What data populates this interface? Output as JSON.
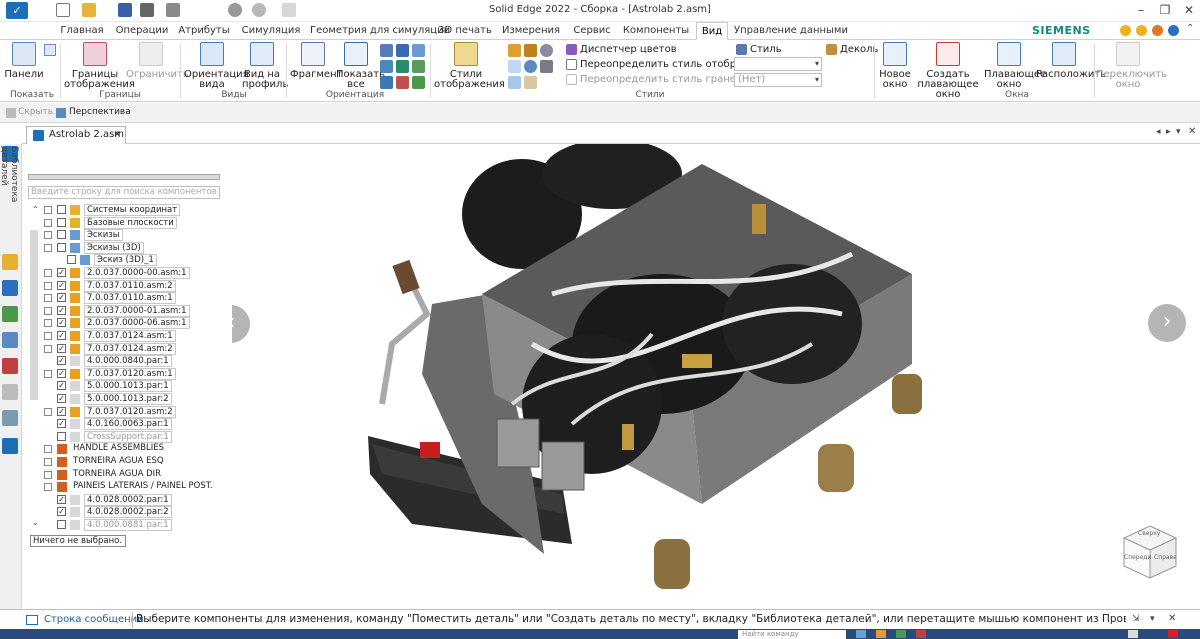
{
  "window": {
    "title": "Solid Edge 2022 - Сборка - [Astrolab 2.asm]",
    "brand": "SIEMENS",
    "brand_color": "#0f8a8a"
  },
  "ribbon_tabs": [
    {
      "label": "Главная"
    },
    {
      "label": "Операции"
    },
    {
      "label": "Атрибуты"
    },
    {
      "label": "Симуляция"
    },
    {
      "label": "Геометрия для симуляции"
    },
    {
      "label": "3D печать"
    },
    {
      "label": "Измерения"
    },
    {
      "label": "Сервис"
    },
    {
      "label": "Компоненты"
    },
    {
      "label": "Вид"
    },
    {
      "label": "Управление данными"
    }
  ],
  "active_tab": "Вид",
  "ribbon": {
    "panels_label": "Панели",
    "show_group": "Показать",
    "bounds_label": "Границы отображения",
    "limit_label": "Ограничить",
    "bounds_group": "Границы",
    "orient_label": "Ориентация вида",
    "profile_label": "Вид на профиль",
    "views_group": "Виды",
    "fragment_label": "Фрагмент",
    "showall_label": "Показать все",
    "orientation_group": "Ориентация",
    "styles_label": "Стили отображения",
    "color_mgr": "Диспетчер цветов",
    "override_display": "Переопределить стиль отображения",
    "override_faces": "Переопределить стиль граней",
    "style_label": "Стиль",
    "decal_label": "Деколь",
    "net_value": "(Нет)",
    "styles_group": "Стили",
    "new_window": "Новое окно",
    "create_floating": "Создать плавающее окно",
    "floating_window": "Плавающее окно",
    "arrange": "Расположить",
    "switch_window": "Переключить окно",
    "window_group": "Окна"
  },
  "subbar": {
    "hide": "Скрыть",
    "perspective": "Перспектива"
  },
  "doc_tab": "Astrolab 2.asm",
  "side_label": "Библиотека деталей",
  "search_placeholder": "Введите строку для поиска компонентов",
  "tree": [
    {
      "label": "Системы координат",
      "expand": true,
      "check": false,
      "kind": "sys",
      "dim": false
    },
    {
      "label": "Базовые плоскости",
      "expand": true,
      "check": false,
      "kind": "plane",
      "dim": false
    },
    {
      "label": "Эскизы",
      "expand": true,
      "check": false,
      "kind": "sketch",
      "dim": false
    },
    {
      "label": "Эскизы (3D)",
      "expand": true,
      "check": false,
      "kind": "sketch",
      "dim": false
    },
    {
      "label": "Эскиз (3D)_1",
      "expand": false,
      "check": false,
      "kind": "sketch",
      "dim": false,
      "indent": 1
    },
    {
      "label": "2.0.037.0000-00.asm:1",
      "expand": true,
      "check": true,
      "kind": "asm",
      "dim": false
    },
    {
      "label": "7.0.037.0110.asm:2",
      "expand": true,
      "check": true,
      "kind": "asm",
      "dim": false
    },
    {
      "label": "7.0.037.0110.asm:1",
      "expand": true,
      "check": true,
      "kind": "asm",
      "dim": false
    },
    {
      "label": "2.0.037.0000-01.asm:1",
      "expand": true,
      "check": true,
      "kind": "asm",
      "dim": false
    },
    {
      "label": "2.0.037.0000-06.asm:1",
      "expand": true,
      "check": true,
      "kind": "asm",
      "dim": false
    },
    {
      "label": "7.0.037.0124.asm:1",
      "expand": true,
      "check": true,
      "kind": "asm",
      "dim": false
    },
    {
      "label": "7.0.037.0124.asm:2",
      "expand": true,
      "check": true,
      "kind": "asm",
      "dim": false
    },
    {
      "label": "4.0.000.0840.par:1",
      "expand": false,
      "check": true,
      "kind": "par",
      "dim": false
    },
    {
      "label": "7.0.037.0120.asm:1",
      "expand": true,
      "check": true,
      "kind": "asm",
      "dim": false
    },
    {
      "label": "5.0.000.1013.par:1",
      "expand": false,
      "check": true,
      "kind": "par",
      "dim": false
    },
    {
      "label": "5.0.000.1013.par:2",
      "expand": false,
      "check": true,
      "kind": "par",
      "dim": false
    },
    {
      "label": "7.0.037.0120.asm:2",
      "expand": true,
      "check": true,
      "kind": "asm",
      "dim": false
    },
    {
      "label": "4.0.160.0063.par:1",
      "expand": false,
      "check": true,
      "kind": "par",
      "dim": false
    },
    {
      "label": "CrossSupport.par:1",
      "expand": false,
      "check": false,
      "kind": "par",
      "dim": true
    },
    {
      "label": "HANDLE ASSEMBLIES",
      "expand": true,
      "check": null,
      "kind": "grp",
      "dim": false
    },
    {
      "label": "TORNEIRA AGUA ESQ",
      "expand": true,
      "check": null,
      "kind": "grp",
      "dim": false
    },
    {
      "label": "TORNEIRA AGUA DIR",
      "expand": true,
      "check": null,
      "kind": "grp",
      "dim": false
    },
    {
      "label": "PAINEIS LATERAIS / PAINEL POST.",
      "expand": true,
      "check": null,
      "kind": "grp",
      "dim": false
    },
    {
      "label": "4.0.028.0002.par:1",
      "expand": false,
      "check": true,
      "kind": "par",
      "dim": false
    },
    {
      "label": "4.0.028.0002.par:2",
      "expand": false,
      "check": true,
      "kind": "par",
      "dim": false
    },
    {
      "label": "4.0.000.0881.par:1",
      "expand": false,
      "check": false,
      "kind": "par",
      "dim": true
    }
  ],
  "selection_status": "Ничего не выбрано.",
  "viewcube": {
    "front": "Спереди",
    "top": "Сверху",
    "right": "Справа"
  },
  "message_bar": {
    "label": "Строка сообщений",
    "text": "Выберите компоненты для изменения, команду \"Поместить деталь\" или \"Создать деталь по месту\", вкладку \"Библиотека деталей\", или перетащите мышью компонент из Проводника Windows."
  },
  "taskbar": {
    "search_placeholder": "Найти команду"
  }
}
